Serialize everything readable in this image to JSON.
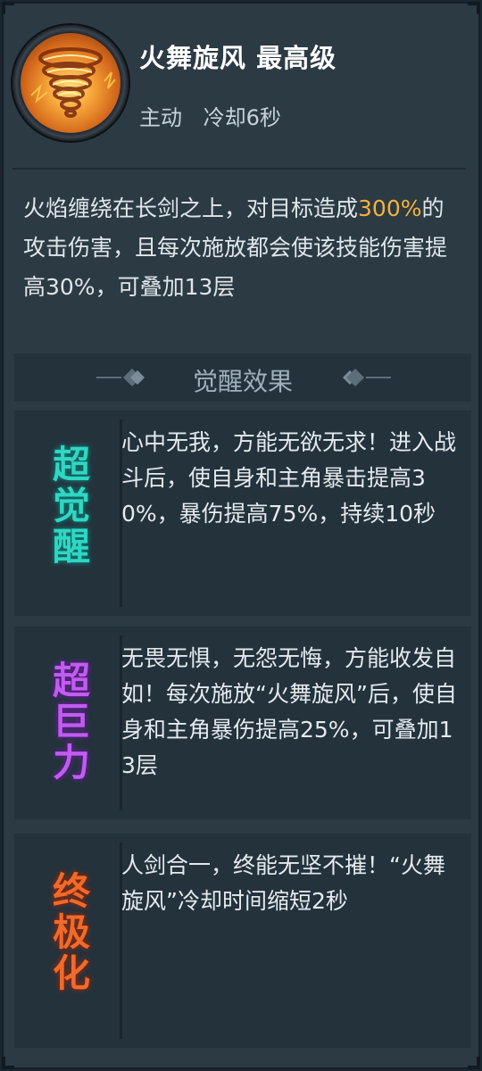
{
  "skill": {
    "name": "火舞旋风 最高级",
    "type": "主动",
    "cooldown": "冷却6秒",
    "icon": "fire-tornado-icon"
  },
  "description": {
    "part1": "火焰缠绕在长剑之上，对目标造成",
    "highlight": "300%",
    "part2": "的攻击伤害，且每次施放都会使该技能伤害提高30%，可叠加13层",
    "highlight_color": "#f3b23c"
  },
  "awaken": {
    "title": "觉醒效果",
    "items": [
      {
        "badge": [
          "超",
          "觉",
          "醒"
        ],
        "badge_color": "#2fd6c4",
        "text": "心中无我，方能无欲无求！进入战斗后，使自身和主角暴击提高30%，暴伤提高75%，持续10秒"
      },
      {
        "badge": [
          "超",
          "巨",
          "力"
        ],
        "badge_color": "#c05cf0",
        "text": "无畏无惧，无怨无悔，方能收发自如！每次施放“火舞旋风”后，使自身和主角暴伤提高25%，可叠加13层"
      },
      {
        "badge": [
          "终",
          "极",
          "化"
        ],
        "badge_color": "#f06a2a",
        "text": "人剑合一，终能无坚不摧！“火舞旋风”冷却时间缩短2秒"
      }
    ]
  }
}
